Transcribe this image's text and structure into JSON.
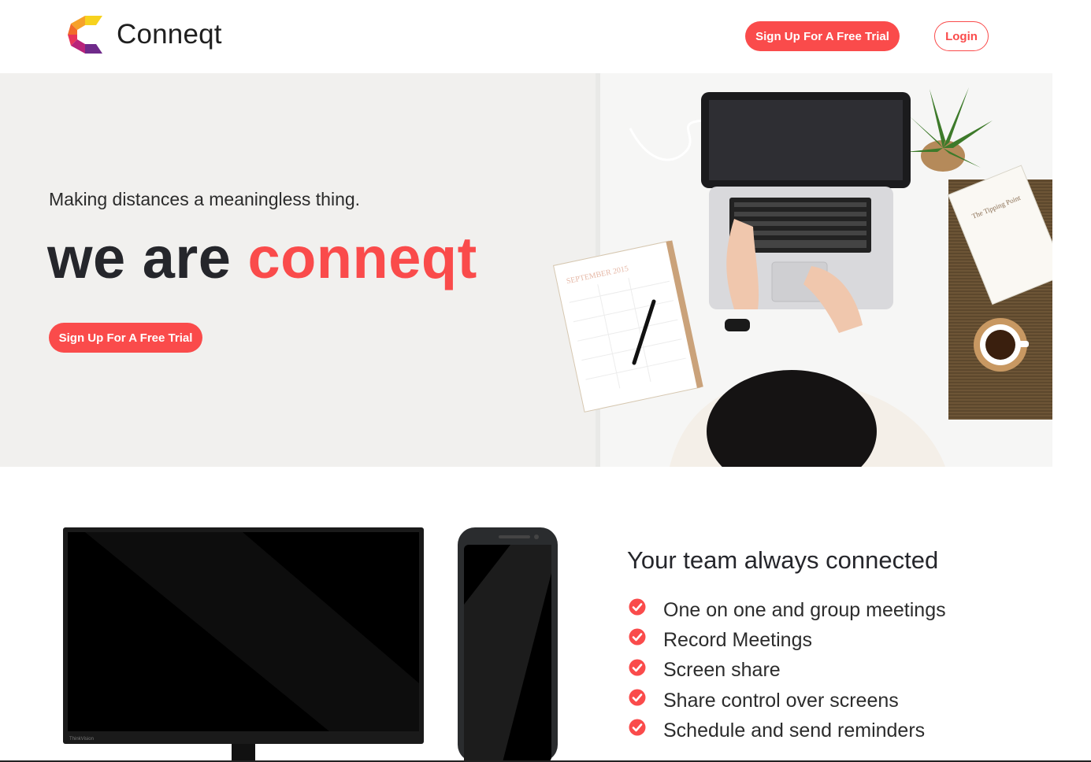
{
  "colors": {
    "accent": "#fa4b4b",
    "text_dark": "#25262b",
    "hero_bg": "#f1f0ee",
    "white": "#ffffff"
  },
  "navbar": {
    "brand_name": "Conneqt",
    "logo_icon": "conneqt-c-logo-icon",
    "signup_label": "Sign Up For A Free Trial",
    "login_label": "Login"
  },
  "hero": {
    "subtitle": "Making distances a meaningless thing.",
    "title_prefix": "we are ",
    "title_accent": "conneqt",
    "cta_label": "Sign Up For A Free Trial",
    "calendar_text": "SEPTEMBER 2015",
    "book_text": "The Tipping Point",
    "monitor_brand": "ThinkVision"
  },
  "features": {
    "title": "Your team always connected",
    "check_icon": "check-circle-icon",
    "items": [
      "One on one and group meetings",
      "Record Meetings",
      "Screen share",
      "Share control over screens",
      "Schedule and send reminders"
    ]
  }
}
